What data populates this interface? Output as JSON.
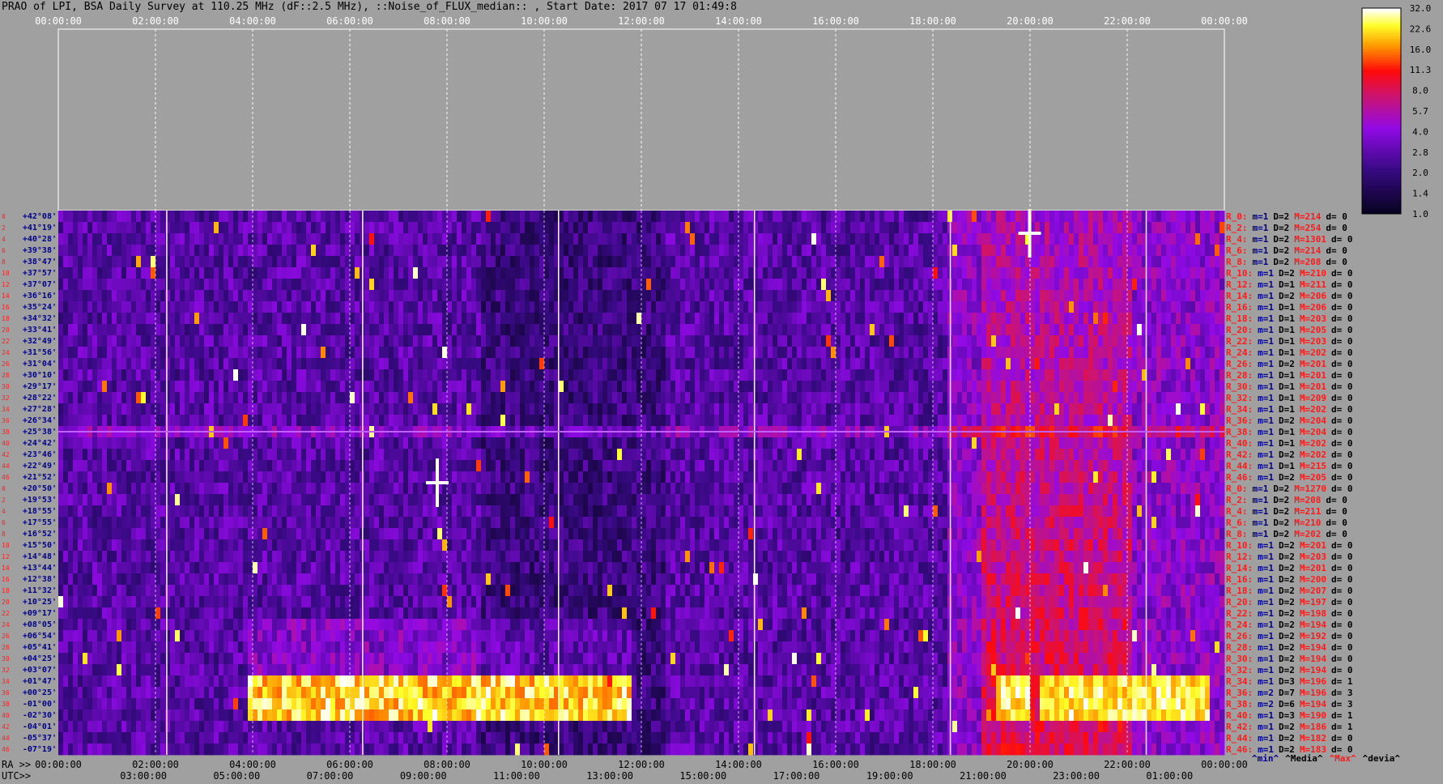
{
  "title": "PRAO of LPI, BSA Daily Survey at 110.25 MHz (dF::2.5 MHz), ::Noise_of_FLUX_median:: , Start Date: 2017 07 17 01:49:8",
  "colors": {
    "background": "#a0a0a0",
    "stat_red": "#ff1a1a",
    "stat_blue": "#00008b"
  },
  "chart_data": {
    "type": "heatmap",
    "colormap": "black-purple-red-yellow-white",
    "top_axis": {
      "labels": [
        "00:00:00",
        "02:00:00",
        "04:00:00",
        "06:00:00",
        "08:00:00",
        "10:00:00",
        "12:00:00",
        "14:00:00",
        "16:00:00",
        "18:00:00",
        "20:00:00",
        "22:00:00",
        "00:00:00"
      ]
    },
    "ra_axis": {
      "name": "RA >>",
      "labels": [
        "00:00:00",
        "02:00:00",
        "04:00:00",
        "06:00:00",
        "08:00:00",
        "10:00:00",
        "12:00:00",
        "14:00:00",
        "16:00:00",
        "18:00:00",
        "20:00:00",
        "22:00:00",
        "00:00:00"
      ]
    },
    "utc_axis": {
      "name": "UTC>>",
      "labels": [
        "03:00:00",
        "05:00:00",
        "07:00:00",
        "09:00:00",
        "11:00:00",
        "13:00:00",
        "15:00:00",
        "17:00:00",
        "19:00:00",
        "21:00:00",
        "23:00:00",
        "01:00:00"
      ]
    },
    "declinations": [
      "+42°08'",
      "+41°19'",
      "+40°28'",
      "+39°38'",
      "+38°47'",
      "+37°57'",
      "+37°07'",
      "+36°16'",
      "+35°24'",
      "+34°32'",
      "+33°41'",
      "+32°49'",
      "+31°56'",
      "+31°04'",
      "+30°10'",
      "+29°17'",
      "+28°22'",
      "+27°28'",
      "+26°34'",
      "+25°38'",
      "+24°42'",
      "+23°46'",
      "+22°49'",
      "+21°52'",
      "+20°50'",
      "+19°53'",
      "+18°55'",
      "+17°55'",
      "+16°52'",
      "+15°50'",
      "+14°48'",
      "+13°44'",
      "+12°38'",
      "+11°32'",
      "+10°25'",
      "+09°17'",
      "+08°05'",
      "+06°54'",
      "+05°41'",
      "+04°25'",
      "+03°07'",
      "+01°47'",
      "+00°25'",
      "-01°00'",
      "-02°30'",
      "-04°01'",
      "-05°37'",
      "-07°19'"
    ],
    "row_numbers": [
      "0",
      "2",
      "4",
      "6",
      "8",
      "10",
      "12",
      "14",
      "16",
      "18",
      "20",
      "22",
      "24",
      "26",
      "28",
      "30",
      "32",
      "34",
      "36",
      "38",
      "40",
      "42",
      "44",
      "46",
      "0",
      "2",
      "4",
      "6",
      "8",
      "10",
      "12",
      "14",
      "16",
      "18",
      "20",
      "22",
      "24",
      "26",
      "28",
      "30",
      "32",
      "34",
      "36",
      "38",
      "40",
      "42",
      "44",
      "46"
    ],
    "colorbar": {
      "ticks": [
        "32.0",
        "22.6",
        "16.0",
        "11.3",
        "8.0",
        "5.7",
        "4.0",
        "2.8",
        "2.0",
        "1.4",
        "1.0"
      ]
    },
    "row_stats": [
      {
        "r": "R_0:",
        "m": "m=1",
        "D": "D=2",
        "M": "M=214",
        "d": "d= 0"
      },
      {
        "r": "R_2:",
        "m": "m=1",
        "D": "D=2",
        "M": "M=254",
        "d": "d= 0"
      },
      {
        "r": "R_4:",
        "m": "m=1",
        "D": "D=2",
        "M": "M=1301",
        "d": "d= 0"
      },
      {
        "r": "R_6:",
        "m": "m=1",
        "D": "D=2",
        "M": "M=214",
        "d": "d= 0"
      },
      {
        "r": "R_8:",
        "m": "m=1",
        "D": "D=2",
        "M": "M=208",
        "d": "d= 0"
      },
      {
        "r": "R_10:",
        "m": "m=1",
        "D": "D=2",
        "M": "M=210",
        "d": "d= 0"
      },
      {
        "r": "R_12:",
        "m": "m=1",
        "D": "D=1",
        "M": "M=211",
        "d": "d= 0"
      },
      {
        "r": "R_14:",
        "m": "m=1",
        "D": "D=2",
        "M": "M=206",
        "d": "d= 0"
      },
      {
        "r": "R_16:",
        "m": "m=1",
        "D": "D=1",
        "M": "M=206",
        "d": "d= 0"
      },
      {
        "r": "R_18:",
        "m": "m=1",
        "D": "D=1",
        "M": "M=203",
        "d": "d= 0"
      },
      {
        "r": "R_20:",
        "m": "m=1",
        "D": "D=1",
        "M": "M=205",
        "d": "d= 0"
      },
      {
        "r": "R_22:",
        "m": "m=1",
        "D": "D=1",
        "M": "M=203",
        "d": "d= 0"
      },
      {
        "r": "R_24:",
        "m": "m=1",
        "D": "D=1",
        "M": "M=202",
        "d": "d= 0"
      },
      {
        "r": "R_26:",
        "m": "m=1",
        "D": "D=2",
        "M": "M=201",
        "d": "d= 0"
      },
      {
        "r": "R_28:",
        "m": "m=1",
        "D": "D=1",
        "M": "M=201",
        "d": "d= 0"
      },
      {
        "r": "R_30:",
        "m": "m=1",
        "D": "D=1",
        "M": "M=201",
        "d": "d= 0"
      },
      {
        "r": "R_32:",
        "m": "m=1",
        "D": "D=1",
        "M": "M=209",
        "d": "d= 0"
      },
      {
        "r": "R_34:",
        "m": "m=1",
        "D": "D=1",
        "M": "M=202",
        "d": "d= 0"
      },
      {
        "r": "R_36:",
        "m": "m=1",
        "D": "D=2",
        "M": "M=204",
        "d": "d= 0"
      },
      {
        "r": "R_38:",
        "m": "m=1",
        "D": "D=1",
        "M": "M=204",
        "d": "d= 0"
      },
      {
        "r": "R_40:",
        "m": "m=1",
        "D": "D=1",
        "M": "M=202",
        "d": "d= 0"
      },
      {
        "r": "R_42:",
        "m": "m=1",
        "D": "D=2",
        "M": "M=202",
        "d": "d= 0"
      },
      {
        "r": "R_44:",
        "m": "m=1",
        "D": "D=1",
        "M": "M=215",
        "d": "d= 0"
      },
      {
        "r": "R_46:",
        "m": "m=1",
        "D": "D=2",
        "M": "M=205",
        "d": "d= 0"
      },
      {
        "r": "R_0:",
        "m": "m=1",
        "D": "D=2",
        "M": "M=1270",
        "d": "d= 0"
      },
      {
        "r": "R_2:",
        "m": "m=1",
        "D": "D=2",
        "M": "M=208",
        "d": "d= 0"
      },
      {
        "r": "R_4:",
        "m": "m=1",
        "D": "D=2",
        "M": "M=211",
        "d": "d= 0"
      },
      {
        "r": "R_6:",
        "m": "m=1",
        "D": "D=2",
        "M": "M=210",
        "d": "d= 0"
      },
      {
        "r": "R_8:",
        "m": "m=1",
        "D": "D=2",
        "M": "M=202",
        "d": "d= 0"
      },
      {
        "r": "R_10:",
        "m": "m=1",
        "D": "D=2",
        "M": "M=201",
        "d": "d= 0"
      },
      {
        "r": "R_12:",
        "m": "m=1",
        "D": "D=2",
        "M": "M=203",
        "d": "d= 0"
      },
      {
        "r": "R_14:",
        "m": "m=1",
        "D": "D=2",
        "M": "M=201",
        "d": "d= 0"
      },
      {
        "r": "R_16:",
        "m": "m=1",
        "D": "D=2",
        "M": "M=200",
        "d": "d= 0"
      },
      {
        "r": "R_18:",
        "m": "m=1",
        "D": "D=2",
        "M": "M=207",
        "d": "d= 0"
      },
      {
        "r": "R_20:",
        "m": "m=1",
        "D": "D=2",
        "M": "M=197",
        "d": "d= 0"
      },
      {
        "r": "R_22:",
        "m": "m=1",
        "D": "D=2",
        "M": "M=198",
        "d": "d= 0"
      },
      {
        "r": "R_24:",
        "m": "m=1",
        "D": "D=2",
        "M": "M=194",
        "d": "d= 0"
      },
      {
        "r": "R_26:",
        "m": "m=1",
        "D": "D=2",
        "M": "M=192",
        "d": "d= 0"
      },
      {
        "r": "R_28:",
        "m": "m=1",
        "D": "D=2",
        "M": "M=194",
        "d": "d= 0"
      },
      {
        "r": "R_30:",
        "m": "m=1",
        "D": "D=2",
        "M": "M=194",
        "d": "d= 0"
      },
      {
        "r": "R_32:",
        "m": "m=1",
        "D": "D=2",
        "M": "M=194",
        "d": "d= 0"
      },
      {
        "r": "R_34:",
        "m": "m=1",
        "D": "D=3",
        "M": "M=196",
        "d": "d= 1"
      },
      {
        "r": "R_36:",
        "m": "m=2",
        "D": "D=7",
        "M": "M=196",
        "d": "d= 3"
      },
      {
        "r": "R_38:",
        "m": "m=2",
        "D": "D=6",
        "M": "M=194",
        "d": "d= 3"
      },
      {
        "r": "R_40:",
        "m": "m=1",
        "D": "D=3",
        "M": "M=190",
        "d": "d= 1"
      },
      {
        "r": "R_42:",
        "m": "m=1",
        "D": "D=2",
        "M": "M=186",
        "d": "d= 1"
      },
      {
        "r": "R_44:",
        "m": "m=1",
        "D": "D=2",
        "M": "M=182",
        "d": "d= 0"
      },
      {
        "r": "R_46:",
        "m": "m=1",
        "D": "D=2",
        "M": "M=183",
        "d": "d= 0"
      }
    ],
    "stat_legend": {
      "min": "^min^",
      "median": "^Media^",
      "max": "^Max^",
      "dev": "^devia^"
    }
  }
}
